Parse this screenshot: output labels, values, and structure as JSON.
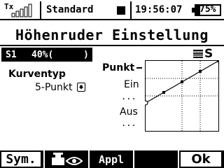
{
  "status": {
    "tx_label": "Tx",
    "model_name": "Standard",
    "time": "19:56:07",
    "battery_percent": "75%"
  },
  "title": "Höhenruder Einstellung",
  "selection": {
    "switch": "S1",
    "value": "40%(",
    "close": ")"
  },
  "curve": {
    "label": "Kurventyp",
    "value": "5-Punkt"
  },
  "mode": {
    "letter": "S"
  },
  "points": {
    "punkt_label": "Punkt",
    "ein_label": "Ein",
    "ein_value": "...",
    "aus_label": "Aus",
    "aus_value": "..."
  },
  "chart_data": {
    "type": "line",
    "x": [
      -100,
      -50,
      0,
      50,
      100
    ],
    "values": [
      -20,
      10,
      40,
      70,
      100
    ],
    "ylim": [
      -100,
      100
    ],
    "xlim": [
      -100,
      100
    ],
    "grid": true
  },
  "softkeys": {
    "sym": "Sym.",
    "appl": "Appl",
    "ok": "Ok"
  }
}
